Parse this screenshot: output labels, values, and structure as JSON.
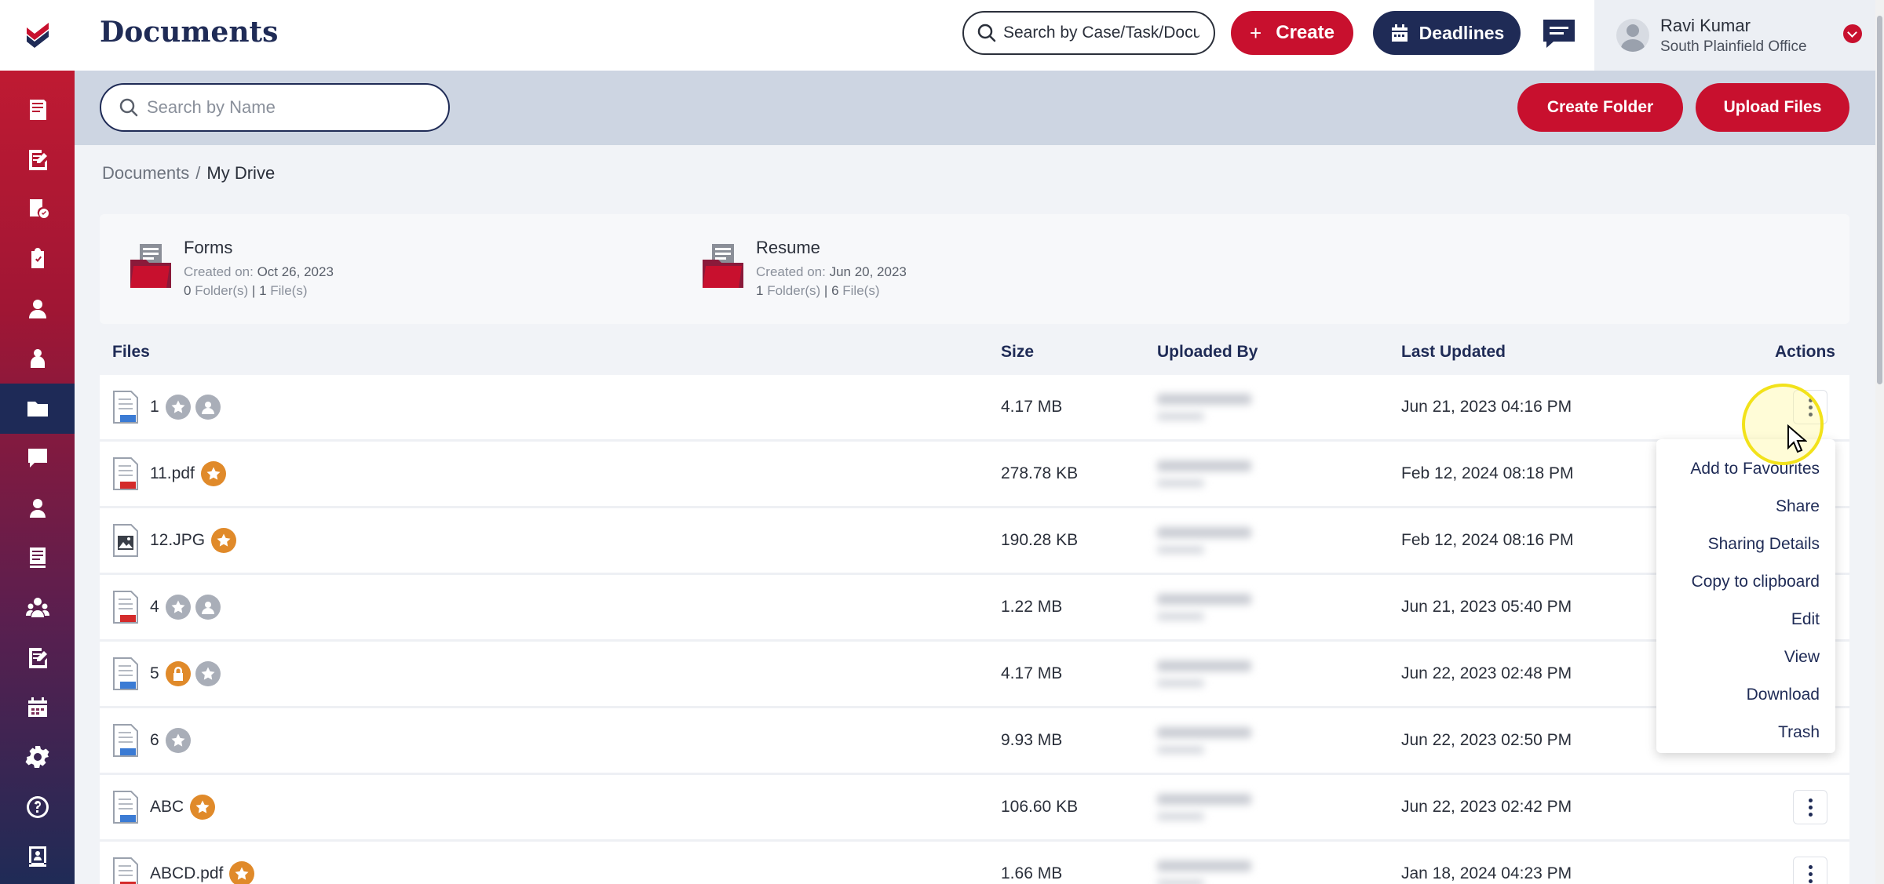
{
  "app": {
    "title": "Documents"
  },
  "topbar": {
    "search_placeholder": "Search by Case/Task/Document",
    "create_label": "Create",
    "create_icon": "+",
    "deadlines_label": "Deadlines",
    "user_name": "Ravi Kumar",
    "user_office": "South Plainfield Office"
  },
  "subbar": {
    "name_search_placeholder": "Search by Name",
    "create_folder_label": "Create Folder",
    "upload_files_label": "Upload Files"
  },
  "breadcrumb": {
    "root": "Documents",
    "separator": "/",
    "current": "My Drive"
  },
  "folders": [
    {
      "name": "Forms",
      "created_label": "Created on: ",
      "created": "Oct 26, 2023",
      "folders_count": "0",
      "folders_label": " Folder(s)",
      "files_count": "1",
      "files_label": " File(s)",
      "divider": " | "
    },
    {
      "name": "Resume",
      "created_label": "Created on: ",
      "created": "Jun 20, 2023",
      "folders_count": "1",
      "folders_label": " Folder(s)",
      "files_count": "6",
      "files_label": " File(s)",
      "divider": " | "
    }
  ],
  "table": {
    "headers": {
      "files": "Files",
      "size": "Size",
      "uploaded_by": "Uploaded By",
      "last_updated": "Last Updated",
      "actions": "Actions"
    },
    "rows": [
      {
        "name": "1",
        "type": "doc",
        "badges": [
          "star-gray",
          "user-gray"
        ],
        "size": "4.17 MB",
        "date": "Jun 21, 2023 04:16 PM"
      },
      {
        "name": "11.pdf",
        "type": "pdf",
        "badges": [
          "star-orange"
        ],
        "size": "278.78 KB",
        "date": "Feb 12, 2024 08:18 PM"
      },
      {
        "name": "12.JPG",
        "type": "img",
        "badges": [
          "star-orange"
        ],
        "size": "190.28 KB",
        "date": "Feb 12, 2024 08:16 PM"
      },
      {
        "name": "4",
        "type": "pdf",
        "badges": [
          "star-gray",
          "user-gray"
        ],
        "size": "1.22 MB",
        "date": "Jun 21, 2023 05:40 PM"
      },
      {
        "name": "5",
        "type": "doc",
        "badges": [
          "lock-orange",
          "star-gray"
        ],
        "size": "4.17 MB",
        "date": "Jun 22, 2023 02:48 PM"
      },
      {
        "name": "6",
        "type": "doc",
        "badges": [
          "star-gray"
        ],
        "size": "9.93 MB",
        "date": "Jun 22, 2023 02:50 PM"
      },
      {
        "name": "ABC",
        "type": "doc",
        "badges": [
          "star-orange"
        ],
        "size": "106.60 KB",
        "date": "Jun 22, 2023 02:42 PM"
      },
      {
        "name": "ABCD.pdf",
        "type": "pdf",
        "badges": [
          "star-orange"
        ],
        "size": "1.66 MB",
        "date": "Jan 18, 2024 04:23 PM"
      }
    ]
  },
  "actions_menu": {
    "items": [
      "Add to Favourites",
      "Share",
      "Sharing Details",
      "Copy to clipboard",
      "Edit",
      "View",
      "Download",
      "Trash"
    ]
  },
  "colors": {
    "brand_red": "#c8102e",
    "brand_navy": "#1f2b56",
    "star_orange": "#e08a2a",
    "badge_gray": "#a9aeb8"
  }
}
